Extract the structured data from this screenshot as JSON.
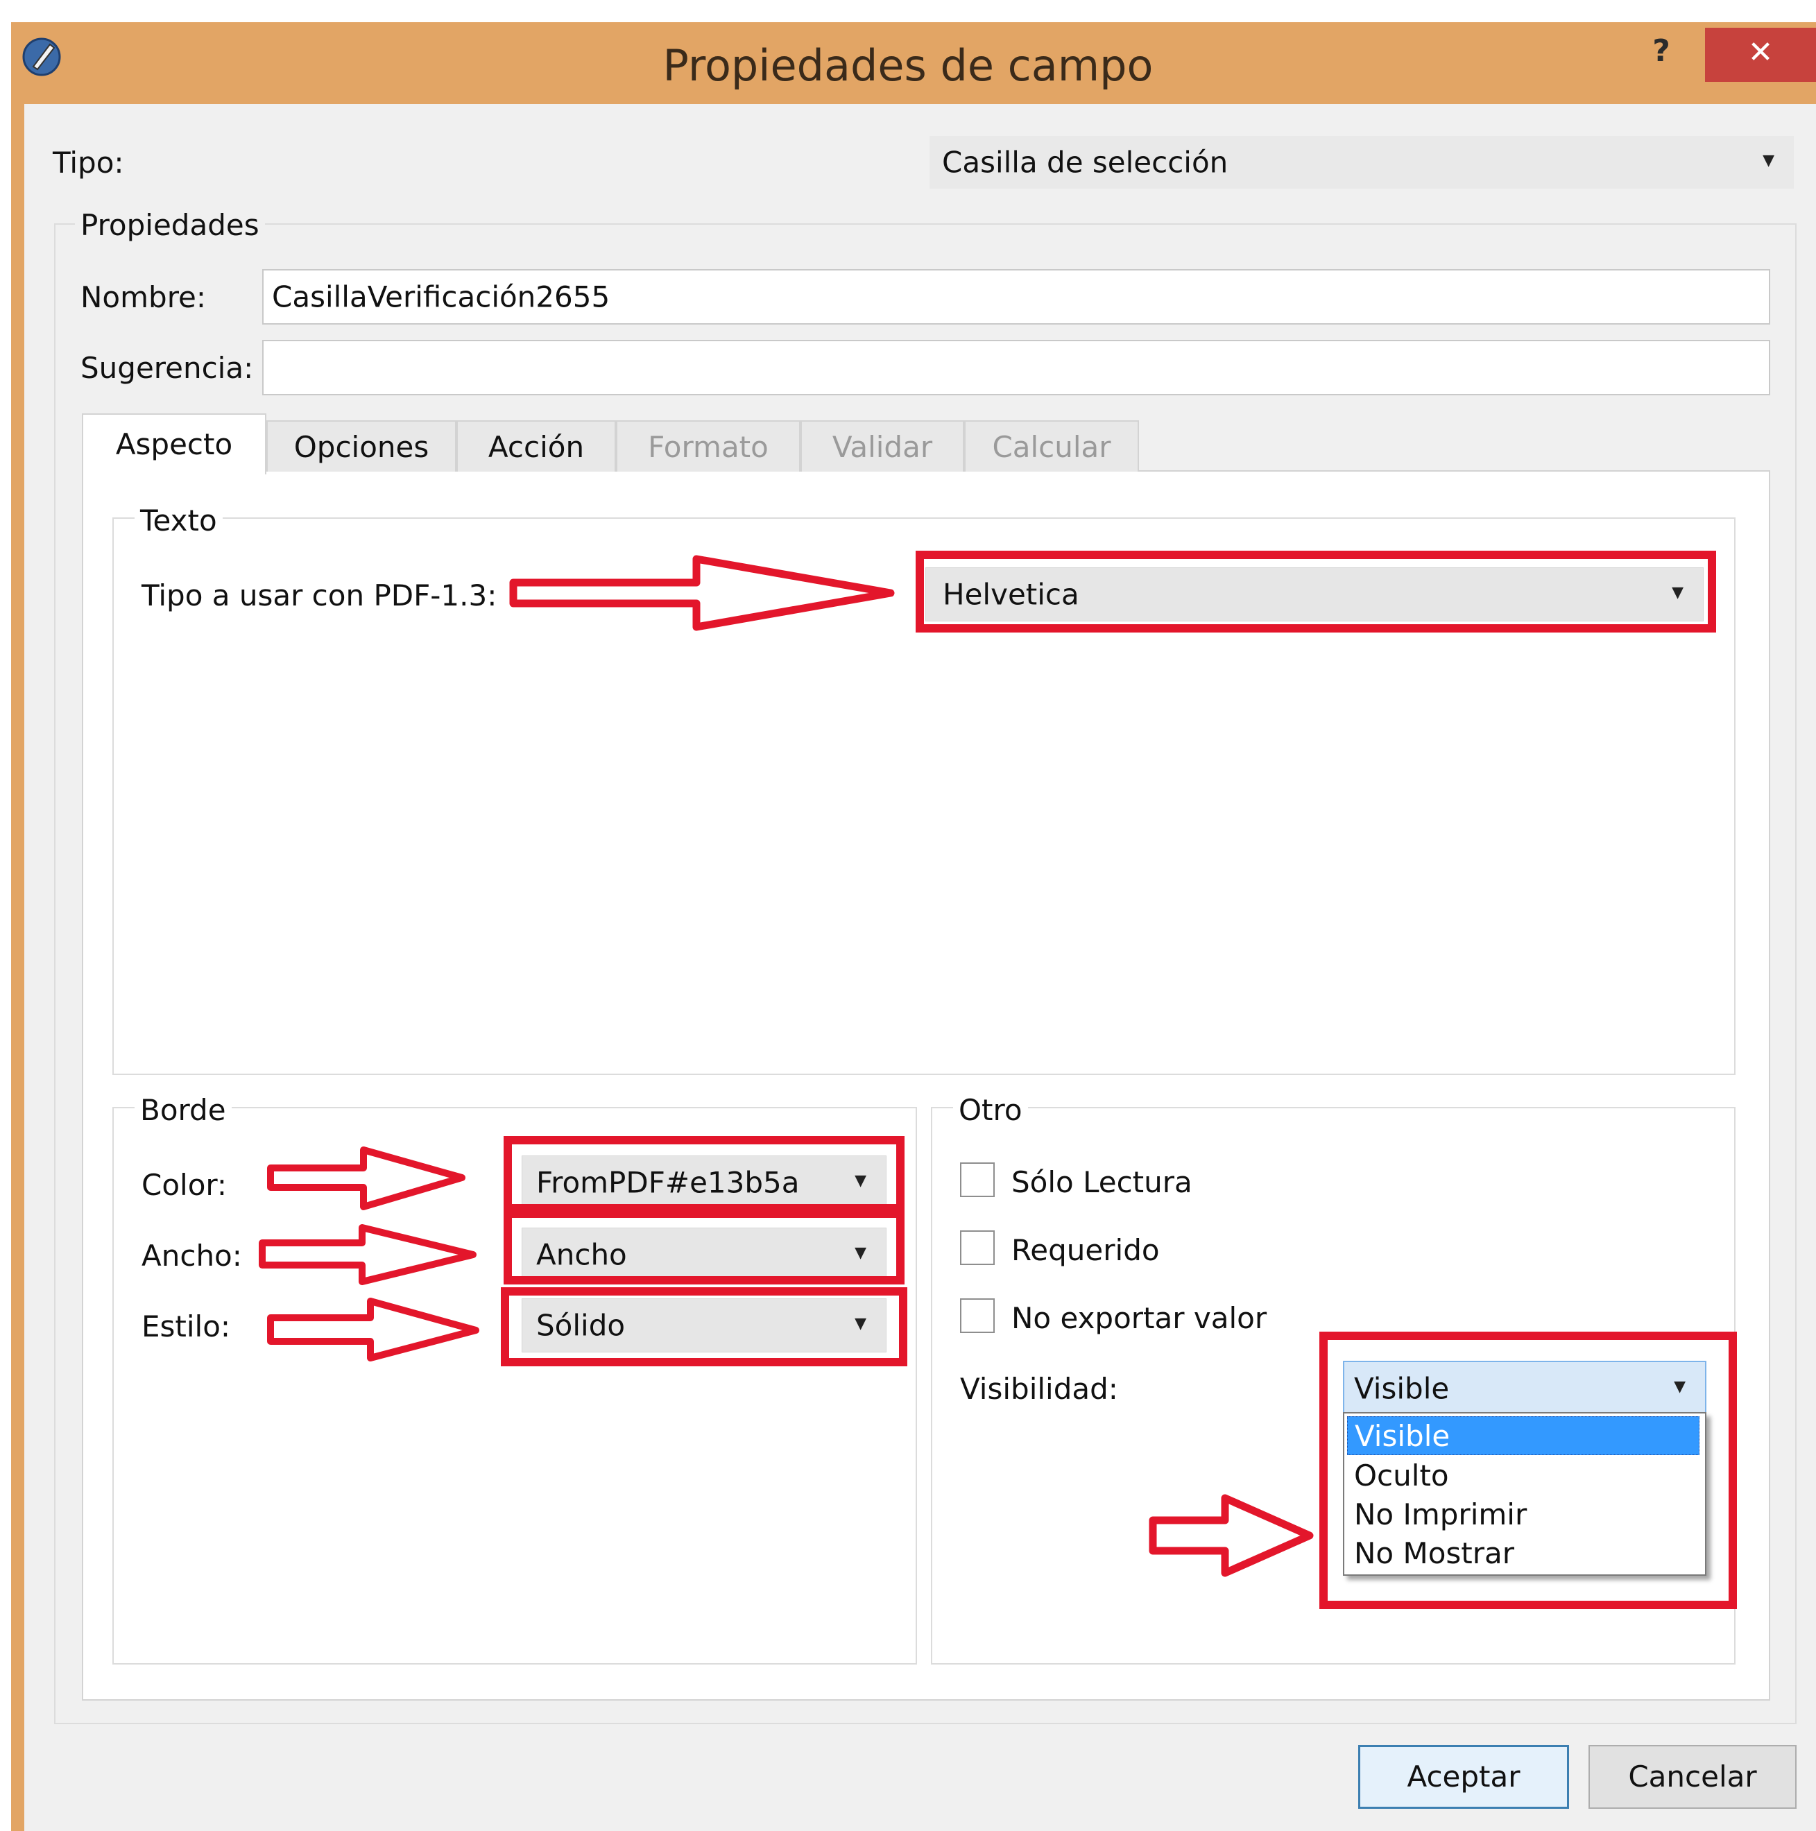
{
  "window": {
    "title": "Propiedades de campo",
    "help_label": "?",
    "close_label": "✕"
  },
  "tipo": {
    "label": "Tipo:",
    "value": "Casilla de selección"
  },
  "propiedades": {
    "group_label": "Propiedades",
    "nombre_label": "Nombre:",
    "nombre_value": "CasillaVerificación2655",
    "sugerencia_label": "Sugerencia:",
    "sugerencia_value": ""
  },
  "tabs": [
    "Aspecto",
    "Opciones",
    "Acción",
    "Formato",
    "Validar",
    "Calcular"
  ],
  "texto": {
    "group_label": "Texto",
    "font_label": "Tipo a usar con PDF-1.3:",
    "font_value": "Helvetica"
  },
  "borde": {
    "group_label": "Borde",
    "color_label": "Color:",
    "color_value": "FromPDF#e13b5a",
    "ancho_label": "Ancho:",
    "ancho_value": "Ancho",
    "estilo_label": "Estilo:",
    "estilo_value": "Sólido"
  },
  "otro": {
    "group_label": "Otro",
    "checkboxes": [
      {
        "label": "Sólo Lectura",
        "checked": false
      },
      {
        "label": "Requerido",
        "checked": false
      },
      {
        "label": "No exportar valor",
        "checked": false
      }
    ],
    "visibilidad_label": "Visibilidad:",
    "visibilidad_value": "Visible",
    "visibilidad_options": [
      "Visible",
      "Oculto",
      "No Imprimir",
      "No Mostrar"
    ]
  },
  "buttons": {
    "accept": "Aceptar",
    "cancel": "Cancelar"
  },
  "colors": {
    "title_bar": "#e2a565",
    "close_button": "#c7423d",
    "annotation": "#e3162b",
    "selection": "#3399ff"
  },
  "icons": {
    "app": "pencil-app-icon",
    "arrow": "annotation-arrow-icon"
  }
}
